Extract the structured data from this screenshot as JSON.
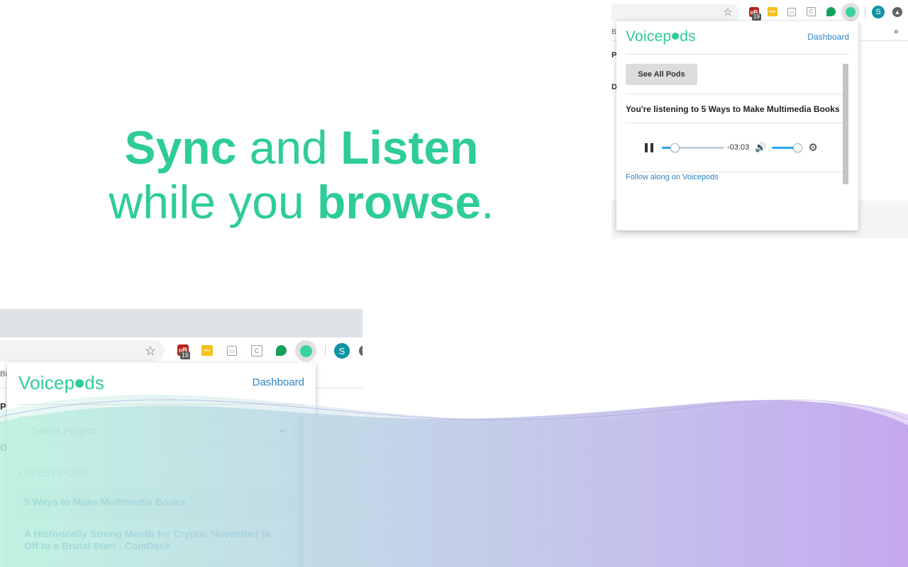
{
  "hero": {
    "line1_strong_a": "Sync",
    "line1_mid": " and ",
    "line1_strong_b": "Listen",
    "line2_pre": "while you ",
    "line2_strong": "browse",
    "line2_end": "."
  },
  "top_popup": {
    "logo_pre": "Voicep",
    "logo_post": "ds",
    "dashboard_label": "Dashboard",
    "see_all_label": "See All Pods",
    "now_playing": "You're listening to 5 Ways to Make Multimedia Books",
    "time_remaining": "-03:03",
    "progress_fraction": 0.2,
    "volume_fraction": 0.85,
    "follow_label": "Follow along on Voicepods"
  },
  "top_browser": {
    "extension_badge": "19",
    "bookmark_fragment": "Bit",
    "overflow": "»",
    "avatar_letter": "S",
    "page_fragments": [
      "P",
      "D"
    ]
  },
  "bottom_browser": {
    "extension_badge": "16",
    "bookmark_fragment": "Bit",
    "avatar_letter": "S",
    "page_fragments": [
      "P",
      "O"
    ]
  },
  "bottom_popup": {
    "logo_pre": "Voicep",
    "logo_post": "ds",
    "dashboard_label": "Dashboard",
    "select_placeholder": "Select Project",
    "latest_label": "LATEST PODS",
    "pods": [
      "5 Ways to Make Multimedia Books",
      "A Historically Strong Month for Crypto, November Is Off to a Brutal Start - CoinDesk"
    ]
  },
  "colors": {
    "brand": "#2ecc9a",
    "link": "#2a83c9",
    "slider": "#2aa3f0",
    "wave_start": "#b6f0dd",
    "wave_end": "#c4a6ef"
  },
  "icons": [
    "star-icon",
    "ublock-icon",
    "toolbar-ext-icon",
    "layout-icon",
    "calendar-icon",
    "hangouts-icon",
    "voicepods-icon",
    "pause-icon",
    "volume-icon",
    "gear-icon"
  ]
}
